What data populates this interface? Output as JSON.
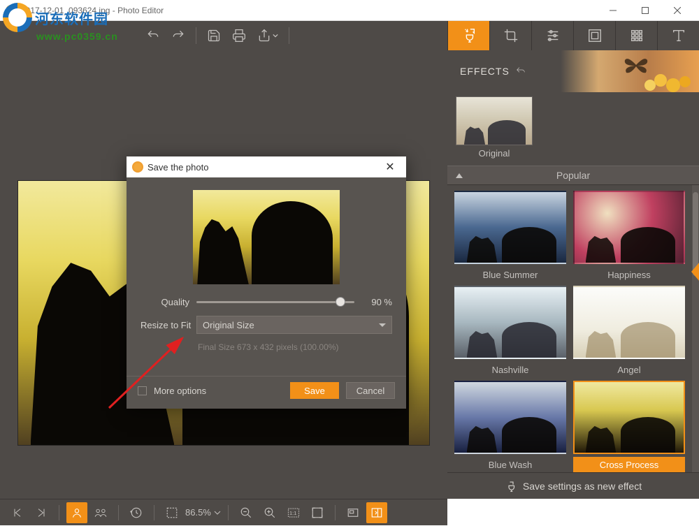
{
  "window": {
    "title": "2017-12-01_093624.jpg - Photo Editor",
    "min_tip": "Minimize",
    "max_tip": "Maximize",
    "close_tip": "Close"
  },
  "watermark": {
    "text": "河东软件园",
    "url": "www.pc0359.cn"
  },
  "toolbar": {
    "undo": "Undo",
    "redo": "Redo",
    "save": "Save",
    "print": "Print",
    "share": "Share"
  },
  "right_tabs": [
    "effects",
    "crop",
    "adjust",
    "frame",
    "texture",
    "text"
  ],
  "effects": {
    "header": "EFFECTS",
    "original": "Original",
    "popular": "Popular",
    "items": [
      {
        "label": "Blue Summer",
        "cls": "fx-bluesummer"
      },
      {
        "label": "Happiness",
        "cls": "fx-happiness"
      },
      {
        "label": "Nashville",
        "cls": "fx-nashville"
      },
      {
        "label": "Angel",
        "cls": "fx-angel"
      },
      {
        "label": "Blue Wash",
        "cls": "fx-bluewash"
      },
      {
        "label": "Cross Process",
        "cls": "fx-cross",
        "selected": true
      }
    ],
    "save_as_effect": "Save settings as new effect"
  },
  "dialog": {
    "title": "Save the photo",
    "quality_label": "Quality",
    "quality_value": "90 %",
    "resize_label": "Resize to Fit",
    "resize_value": "Original Size",
    "final_size": "Final Size 673 x 432 pixels (100.00%)",
    "more_options": "More options",
    "save": "Save",
    "cancel": "Cancel"
  },
  "bottombar": {
    "zoom": "86.5%"
  }
}
